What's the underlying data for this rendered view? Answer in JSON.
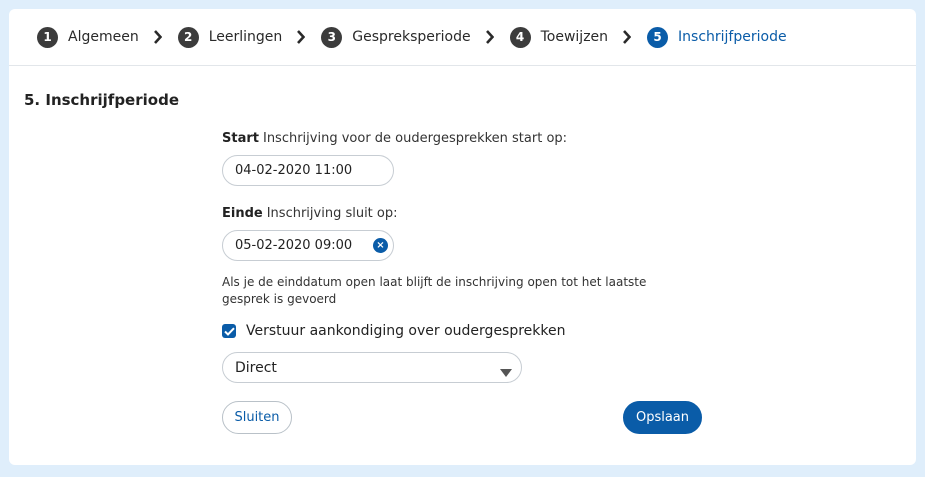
{
  "steps": [
    {
      "number": "1",
      "label": "Algemeen"
    },
    {
      "number": "2",
      "label": "Leerlingen"
    },
    {
      "number": "3",
      "label": "Gespreksperiode"
    },
    {
      "number": "4",
      "label": "Toewijzen"
    },
    {
      "number": "5",
      "label": "Inschrijfperiode"
    }
  ],
  "active_step": "5",
  "section_title": "5. Inschrijfperiode",
  "start": {
    "label_bold": "Start",
    "label_text": "Inschrijving voor de oudergesprekken start op:",
    "value": "04-02-2020 11:00"
  },
  "end": {
    "label_bold": "Einde",
    "label_text": "Inschrijving sluit op:",
    "value": "05-02-2020 09:00",
    "hint": "Als je de einddatum open laat blijft de inschrijving open tot het laatste gesprek is gevoerd"
  },
  "announce": {
    "label": "Verstuur aankondiging over oudergesprekken",
    "checked": true
  },
  "timing_select": {
    "selected": "Direct"
  },
  "buttons": {
    "close": "Sluiten",
    "save": "Opslaan"
  },
  "colors": {
    "accent": "#0a5ca8",
    "step_inactive": "#3c3c3c",
    "background": "#dfeefb"
  }
}
